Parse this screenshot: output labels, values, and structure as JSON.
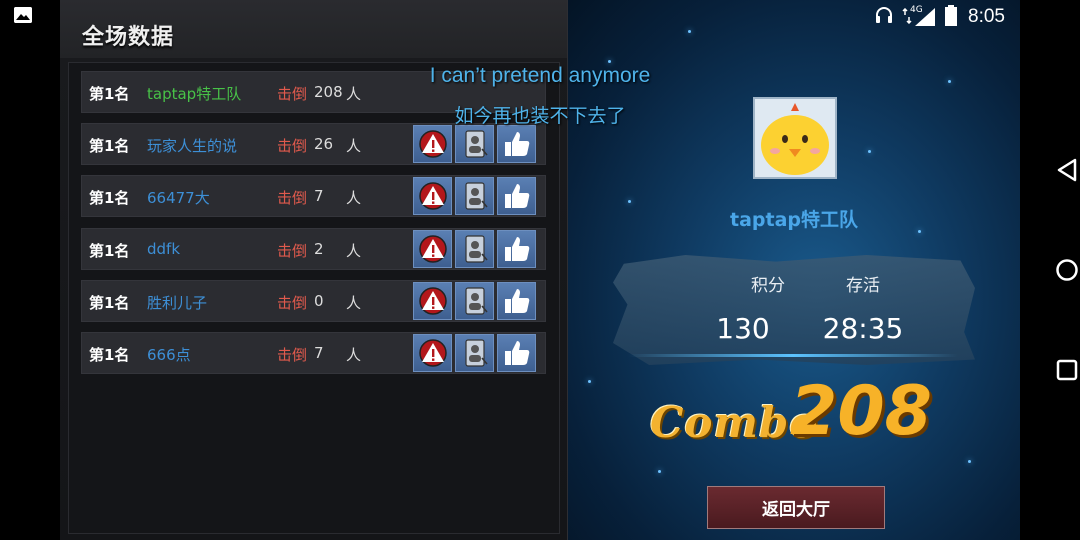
{
  "status_bar": {
    "time": "8:05",
    "network": "4G",
    "icons": [
      "gallery-icon",
      "headphones-icon",
      "data-arrows-icon",
      "signal-icon",
      "battery-icon"
    ]
  },
  "stats_panel": {
    "title": "全场数据",
    "rows": [
      {
        "rank": "第1名",
        "name": "taptap特工队",
        "kill_label": "击倒",
        "kills": "208",
        "unit": "人",
        "actions": false
      },
      {
        "rank": "第1名",
        "name": "玩家人生的说",
        "kill_label": "击倒",
        "kills": "26",
        "unit": "人",
        "actions": true
      },
      {
        "rank": "第1名",
        "name": "66477大",
        "kill_label": "击倒",
        "kills": "7",
        "unit": "人",
        "actions": true
      },
      {
        "rank": "第1名",
        "name": "ddfk",
        "kill_label": "击倒",
        "kills": "2",
        "unit": "人",
        "actions": true
      },
      {
        "rank": "第1名",
        "name": "胜利儿子",
        "kill_label": "击倒",
        "kills": "0",
        "unit": "人",
        "actions": true
      },
      {
        "rank": "第1名",
        "name": "666点",
        "kill_label": "击倒",
        "kills": "7",
        "unit": "人",
        "actions": true
      }
    ],
    "action_icons": [
      "warning-icon",
      "profile-card-icon",
      "thumbs-up-icon"
    ]
  },
  "captions": {
    "en": "I can’t pretend anymore",
    "zh": "如今再也装不下去了"
  },
  "result_panel": {
    "player_name": "taptap特工队",
    "score_label": "积分",
    "survive_label": "存活",
    "score": "130",
    "survive_time": "28:35",
    "combo_label": "Combo",
    "combo_value": "208",
    "back_button": "返回大厅"
  },
  "colors": {
    "accent_green": "#48c248",
    "name_blue": "#3d8fd6",
    "kill_red": "#e05a4d",
    "combo_gold": "#f7b228",
    "caption_blue": "#4fb3ea"
  },
  "nav_bar": [
    "back-triangle-icon",
    "home-circle-icon",
    "recents-square-icon"
  ]
}
